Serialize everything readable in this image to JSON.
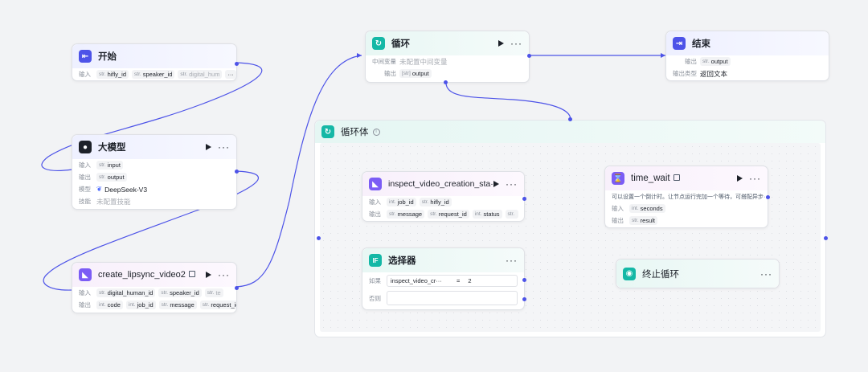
{
  "labels": {
    "input": "输入",
    "output": "输出",
    "model": "模型",
    "skill": "技能",
    "intermediate": "中间变量",
    "output_type": "输出类型",
    "if": "如果",
    "else": "否则"
  },
  "start": {
    "title": "开始",
    "inputs": [
      {
        "type": "str.",
        "name": "hifly_id"
      },
      {
        "type": "str.",
        "name": "speaker_id"
      },
      {
        "type": "str.",
        "name": "digital_hum"
      }
    ],
    "more": "···"
  },
  "llm": {
    "title": "大模型",
    "input": {
      "type": "str.",
      "name": "input"
    },
    "output": {
      "type": "str.",
      "name": "output"
    },
    "model": "DeepSeek-V3",
    "skill": "未配置技能"
  },
  "lipsync": {
    "title": "create_lipsync_video2",
    "inputs": [
      {
        "type": "str.",
        "name": "digital_human_id"
      },
      {
        "type": "str.",
        "name": "speaker_id"
      },
      {
        "type": "str.",
        "name": "te"
      }
    ],
    "outputs": [
      {
        "type": "int.",
        "name": "code"
      },
      {
        "type": "int.",
        "name": "job_id"
      },
      {
        "type": "str.",
        "name": "message"
      },
      {
        "type": "str.",
        "name": "request_id"
      }
    ]
  },
  "loop": {
    "title": "循环",
    "intermediate": "未配置中间变量",
    "output": {
      "type": "[str]",
      "name": "output"
    }
  },
  "end": {
    "title": "结束",
    "output": {
      "type": "str.",
      "name": "output"
    },
    "output_type": "返回文本"
  },
  "loop_body": {
    "title": "循环体",
    "info": "i"
  },
  "inspect": {
    "title": "inspect_video_creation_sta···",
    "inputs": [
      {
        "type": "int.",
        "name": "job_id"
      },
      {
        "type": "str.",
        "name": "hifly_id"
      }
    ],
    "outputs": [
      {
        "type": "str.",
        "name": "message"
      },
      {
        "type": "str.",
        "name": "request_id"
      },
      {
        "type": "int.",
        "name": "status"
      },
      {
        "type": "str.",
        "name": ""
      }
    ]
  },
  "selector": {
    "title": "选择器",
    "icon": "IF",
    "condition_left": "inspect_video_cr···",
    "operator": "=",
    "condition_right": "2"
  },
  "time_wait": {
    "title": "time_wait",
    "description": "可以设置一个倒计时。让节点运行完加一个等待，可搭配异步···",
    "input": {
      "type": "int.",
      "name": "seconds"
    },
    "output": {
      "type": "str.",
      "name": "result"
    }
  },
  "stop_loop": {
    "title": "终止循环"
  },
  "colors": {
    "wire": "#4d53e8",
    "accent": "#4d53e8",
    "teal": "#14b8a6",
    "purple": "#7b5cf5"
  }
}
